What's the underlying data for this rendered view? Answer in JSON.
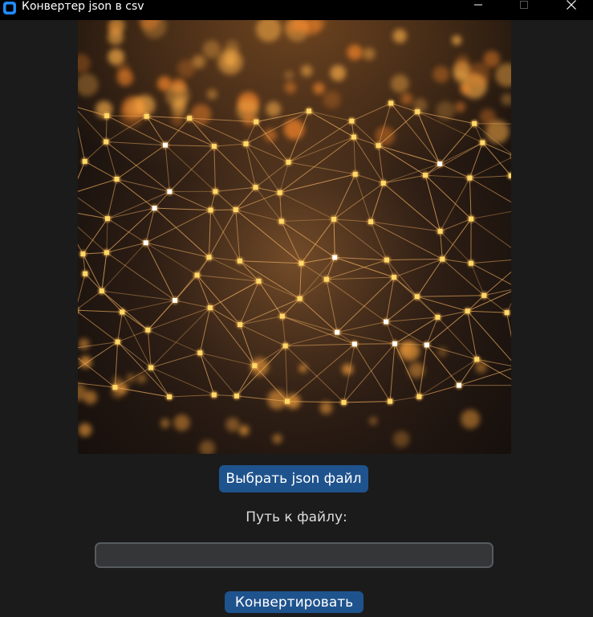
{
  "window": {
    "title": "Конвертер json в csv",
    "controls": {
      "minimize_icon": "minimize-icon",
      "maximize_icon": "maximize-icon",
      "close_icon": "close-icon"
    }
  },
  "main": {
    "image": {
      "description_icon": "network-mesh-image"
    },
    "select_button_label": "Выбрать json файл",
    "path_label": "Путь к файлу:",
    "path_input": {
      "value": "",
      "placeholder": ""
    },
    "convert_button_label": "Конвертировать"
  },
  "colors": {
    "window_background": "#1b1b1b",
    "titlebar_background": "#000000",
    "button_background": "#1f538d",
    "input_background": "#343638",
    "input_border": "#565b5e",
    "accent_orange": "#ffb347"
  }
}
